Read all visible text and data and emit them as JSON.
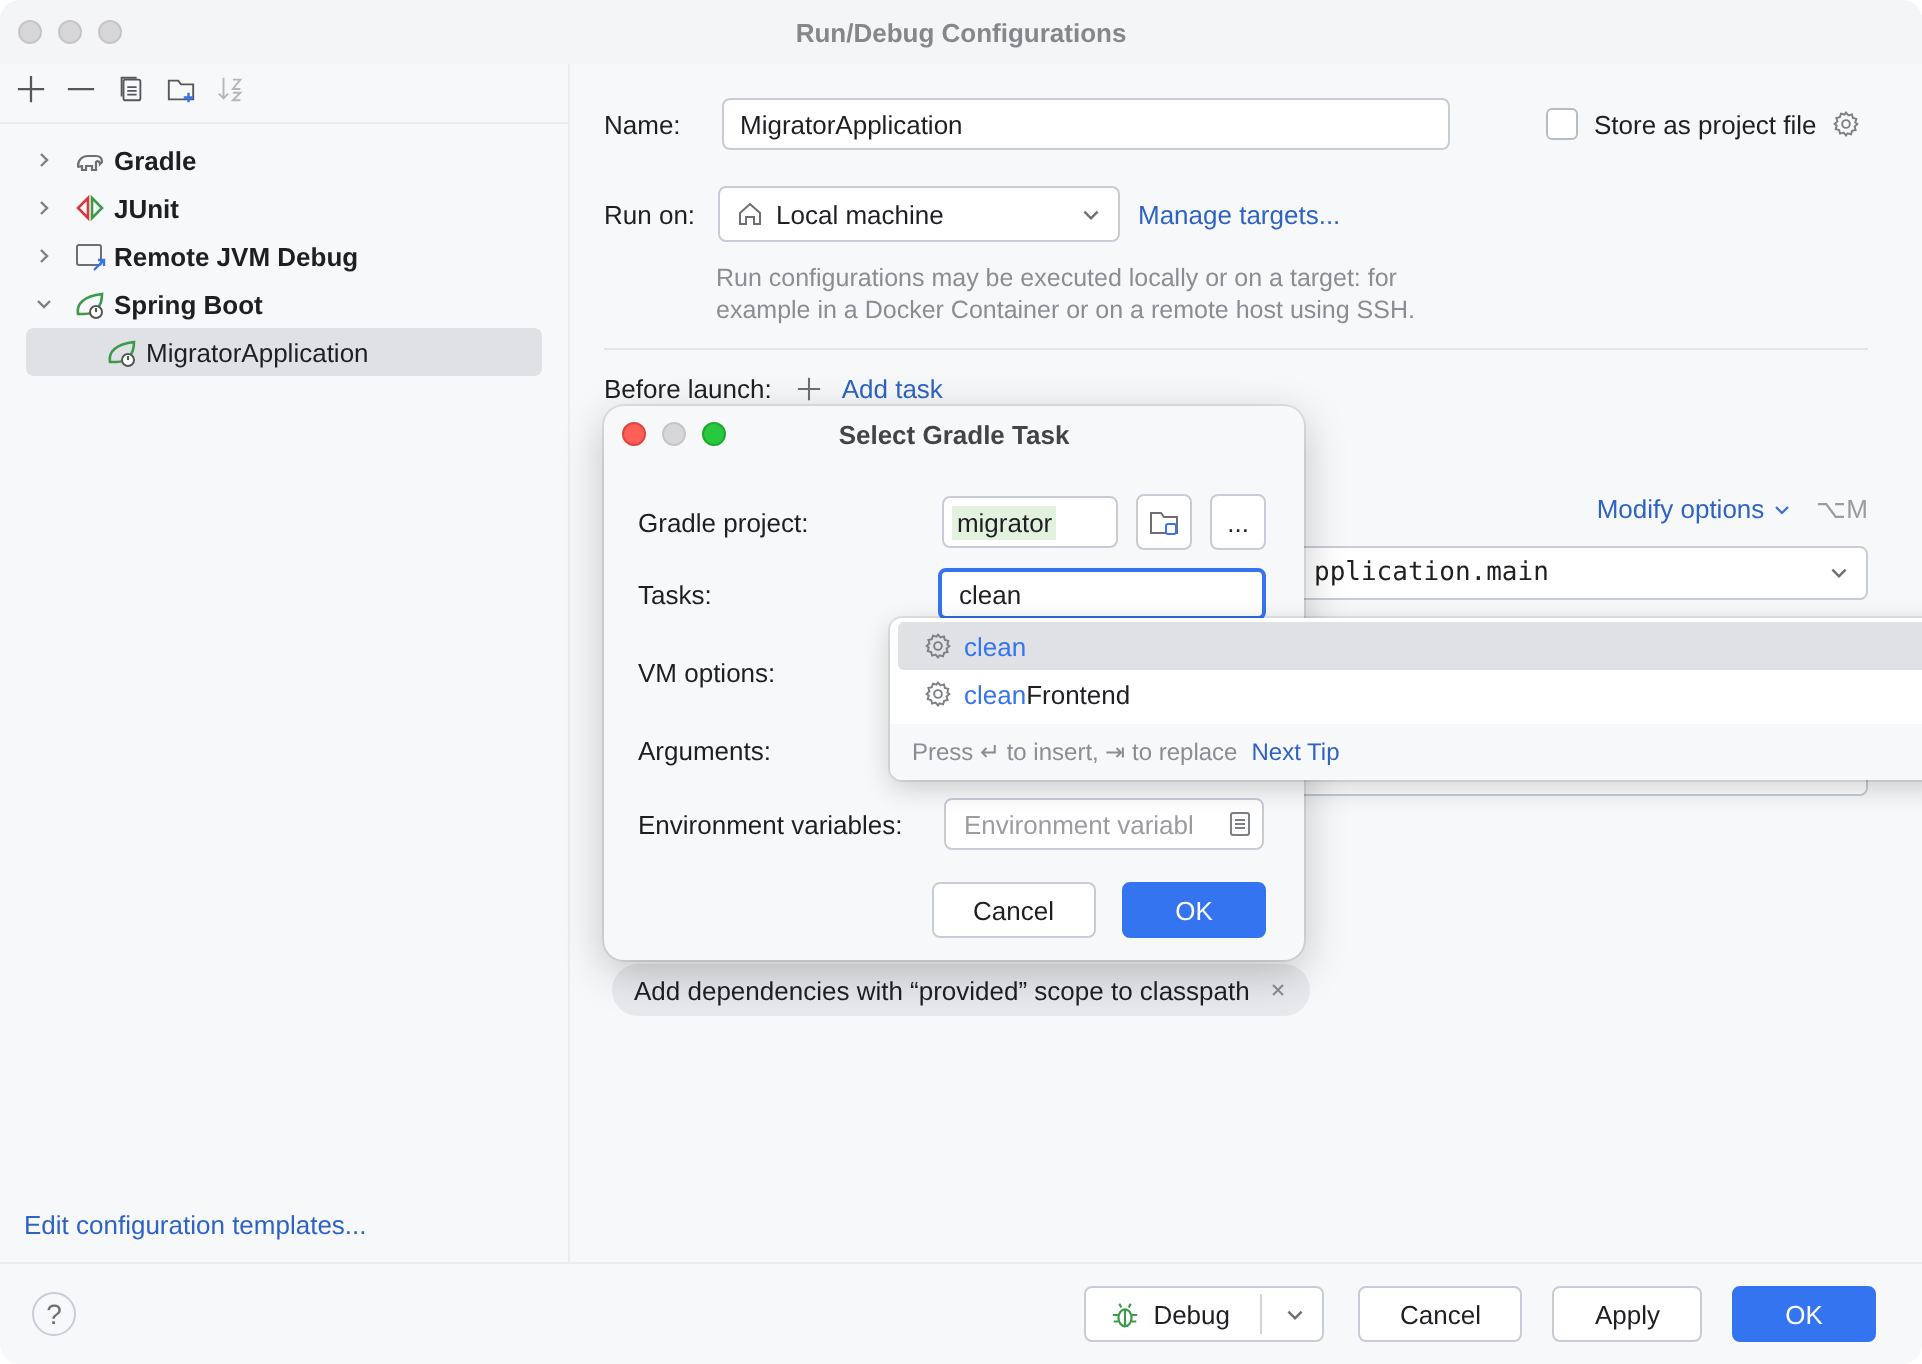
{
  "window": {
    "title": "Run/Debug Configurations"
  },
  "toolbar": [
    {
      "kind": "add",
      "disabled": false
    },
    {
      "kind": "remove",
      "disabled": false
    },
    {
      "kind": "copy",
      "disabled": false
    },
    {
      "kind": "new-folder",
      "disabled": false
    },
    {
      "kind": "sort",
      "disabled": true
    }
  ],
  "tree": [
    {
      "label": "Gradle",
      "kind": "gradle",
      "expanded": false,
      "selected": false
    },
    {
      "label": "JUnit",
      "kind": "junit",
      "expanded": false,
      "selected": false
    },
    {
      "label": "Remote JVM Debug",
      "kind": "remote",
      "expanded": false,
      "selected": false
    },
    {
      "label": "Spring Boot",
      "kind": "spring",
      "expanded": true,
      "selected": false,
      "children": [
        {
          "label": "MigratorApplication",
          "kind": "spring",
          "selected": true
        }
      ]
    }
  ],
  "edit_templates_link": "Edit configuration templates...",
  "form": {
    "name_label": "Name:",
    "name_value": "MigratorApplication",
    "store": {
      "label": "Store as project file",
      "checked": false
    },
    "run_on_label": "Run on:",
    "run_on_value": "Local machine",
    "manage_targets": "Manage targets...",
    "hint": "Run configurations may be executed locally or on a target: for example in a Docker Container or on a remote host using SSH.",
    "before_launch_label": "Before launch:",
    "add_task": "Add task",
    "modify_options": "Modify options",
    "modify_shortcut": "⌥M",
    "main_class": "pplication.main",
    "chip": "Add dependencies with “provided” scope to classpath"
  },
  "dialog": {
    "title": "Select Gradle Task",
    "fields": [
      {
        "label": "Gradle project:",
        "kind": "project",
        "value": "migrator",
        "more": "..."
      },
      {
        "label": "Tasks:",
        "kind": "text",
        "value": "clean",
        "focused": true
      },
      {
        "label": "VM options:",
        "kind": "covered"
      },
      {
        "label": "Arguments:",
        "kind": "covered"
      },
      {
        "label": "Environment variables:",
        "kind": "env",
        "placeholder": "Environment variabl"
      }
    ],
    "buttons": [
      {
        "label": "Cancel",
        "kind": "secondary"
      },
      {
        "label": "OK",
        "kind": "primary"
      }
    ]
  },
  "completion": {
    "items": [
      {
        "match": "clean",
        "selected": true
      },
      {
        "match": "clean",
        "rest": "Frontend",
        "selected": false
      }
    ],
    "hint": "Press ↵ to insert, ⇥ to replace",
    "link": "Next Tip"
  },
  "footer": {
    "help": "?",
    "run_button": "Debug",
    "buttons": [
      {
        "label": "Cancel",
        "kind": "secondary"
      },
      {
        "label": "Apply",
        "kind": "secondary"
      },
      {
        "label": "OK",
        "kind": "primary"
      }
    ]
  }
}
